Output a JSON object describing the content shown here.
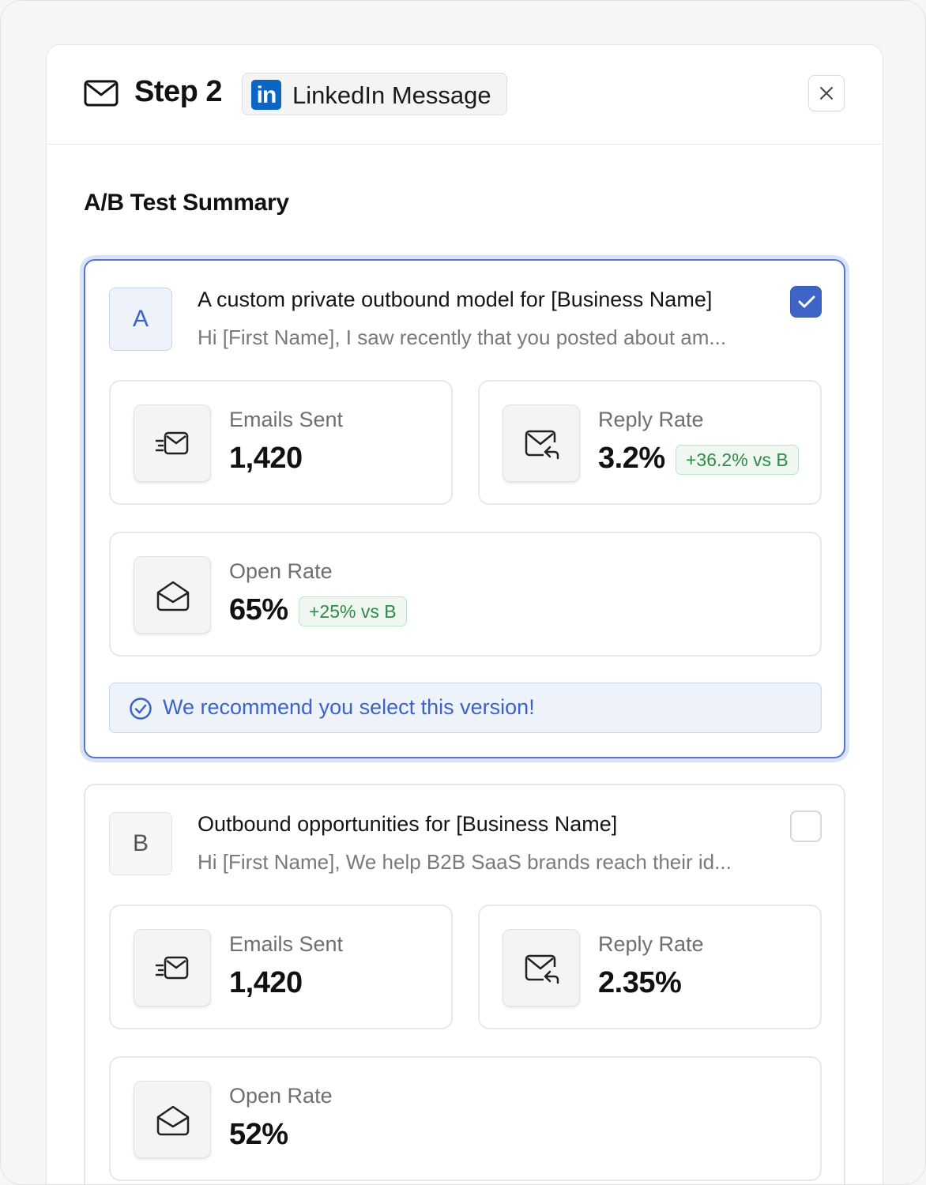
{
  "header": {
    "step_title": "Step 2",
    "channel": "LinkedIn Message",
    "channel_logo_text": "in",
    "channel_color": "#0a66c2"
  },
  "section_title": "A/B Test Summary",
  "variants": [
    {
      "letter": "A",
      "subject": "A custom private outbound model for [Business Name]",
      "preview": "Hi [First Name], I saw recently that you posted about am...",
      "selected": true,
      "stats": {
        "emails_sent": {
          "label": "Emails Sent",
          "value": "1,420",
          "icon": "send-mail-icon"
        },
        "reply_rate": {
          "label": "Reply Rate",
          "value": "3.2%",
          "delta": "+36.2% vs B",
          "icon": "mail-reply-icon"
        },
        "open_rate": {
          "label": "Open Rate",
          "value": "65%",
          "delta": "+25% vs B",
          "icon": "open-envelope-icon"
        }
      },
      "recommendation": "We recommend you select this version!"
    },
    {
      "letter": "B",
      "subject": "Outbound opportunities for [Business Name]",
      "preview": "Hi [First Name], We help B2B SaaS brands reach their id...",
      "selected": false,
      "stats": {
        "emails_sent": {
          "label": "Emails Sent",
          "value": "1,420",
          "icon": "send-mail-icon"
        },
        "reply_rate": {
          "label": "Reply Rate",
          "value": "2.35%",
          "icon": "mail-reply-icon"
        },
        "open_rate": {
          "label": "Open Rate",
          "value": "52%",
          "icon": "open-envelope-icon"
        }
      }
    }
  ],
  "colors": {
    "accent": "#3f64c8",
    "positive": "#2f8a47"
  }
}
